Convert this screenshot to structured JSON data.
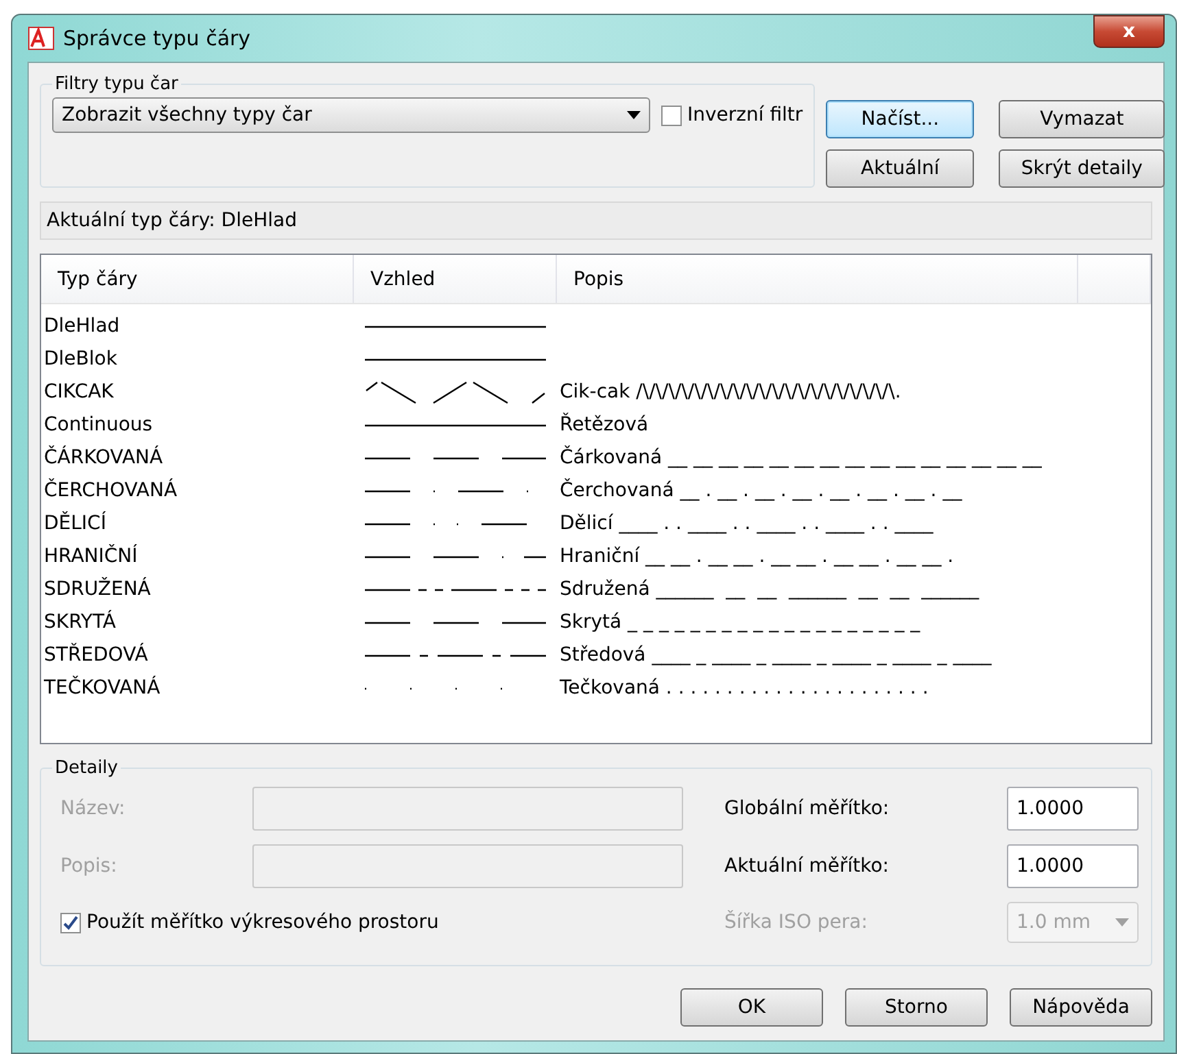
{
  "window": {
    "title": "Správce typu čáry",
    "close": "x"
  },
  "filter": {
    "legend": "Filtry typu čar",
    "value": "Zobrazit všechny typy čar",
    "invert_label": "Inverzní filtr",
    "invert_checked": false
  },
  "buttons_top": [
    {
      "label": "Načíst...",
      "focused": true
    },
    {
      "label": "Vymazat",
      "focused": false
    },
    {
      "label": "Aktuální",
      "focused": false
    },
    {
      "label": "Skrýt detaily",
      "focused": false
    }
  ],
  "current": "Aktuální typ čáry:  DleHlad",
  "table": {
    "columns": [
      "Typ čáry",
      "Vzhled",
      "Popis"
    ],
    "rows": [
      {
        "name": "DleHlad",
        "kind": "solid"
      },
      {
        "name": "DleBlok",
        "kind": "solid"
      },
      {
        "name": "CIKCAK",
        "kind": "zigzag",
        "description": "Cik-cak /\\/\\/\\/\\/\\/\\/\\/\\/\\/\\/\\/\\/\\/\\/\\/\\/\\/\\/\\/\\."
      },
      {
        "name": "Continuous",
        "kind": "solid",
        "description": "Řetězová"
      },
      {
        "name": "ČÁRKOVANÁ",
        "kind": "dashed",
        "description": "Čárkovaná __ __ __ __ __ __ __ __ __ __ __ __ __ __ __"
      },
      {
        "name": "ČERCHOVANÁ",
        "kind": "dashdot",
        "description": "Čerchovaná __ . __ . __ . __ . __ . __ . __ . __"
      },
      {
        "name": "DĚLICÍ",
        "kind": "divide",
        "description": "Dělicí ____ . . ____ . . ____ . . ____ . . ____"
      },
      {
        "name": "HRANIČNÍ",
        "kind": "border",
        "description": "Hraniční __ __ . __ __ . __ __ . __ __ . __ __ ."
      },
      {
        "name": "SDRUŽENÁ",
        "kind": "phantom",
        "description": "Sdružená ______  __  __  ______  __  __  ______"
      },
      {
        "name": "SKRYTÁ",
        "kind": "dashed",
        "description": "Skrytá _ _ _ _ _ _ _ _ _ _ _ _ _ _ _ _ _ _ _"
      },
      {
        "name": "STŘEDOVÁ",
        "kind": "center",
        "description": "Středová ____ _ ____ _ ____ _ ____ _ ____ _ ____"
      },
      {
        "name": "TEČKOVANÁ",
        "kind": "dot",
        "description": "Tečkovaná . . . . . . . . . . . . . . . . . . . . . ."
      }
    ]
  },
  "details": {
    "legend": "Detaily",
    "name_label": "Název:",
    "desc_label": "Popis:",
    "use_paper_label": "Použít měřítko výkresového prostoru",
    "use_paper_checked": true,
    "global_label": "Globální měřítko:",
    "global_value": "1.0000",
    "current_label": "Aktuální měřítko:",
    "current_value": "1.0000",
    "pen_label": "Šířka ISO pera:",
    "pen_value": "1.0 mm"
  },
  "buttons_bottom": [
    "OK",
    "Storno",
    "Nápověda"
  ]
}
